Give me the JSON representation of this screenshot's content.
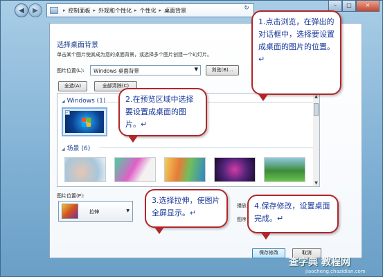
{
  "window": {
    "breadcrumbs": [
      "控制面板",
      "外观和个性化",
      "个性化",
      "桌面背景"
    ],
    "buttons": {
      "minimize": "–",
      "maximize": "□",
      "close": "×"
    }
  },
  "page": {
    "heading": "选择桌面背景",
    "description": "单击某个图片使其成为您的桌面背景，或选择多个图片创建一个幻灯片。",
    "location_label": "图片位置(L):",
    "location_value": "Windows 桌面背景",
    "browse_label": "浏览(B)...",
    "select_all_label": "全选(A)",
    "clear_all_label": "全部清除(C)"
  },
  "preview": {
    "groups": [
      {
        "name": "Windows (1)"
      },
      {
        "name": "场景 (6)"
      }
    ]
  },
  "position": {
    "label": "图片位置(P):",
    "value": "拉伸",
    "side_fragment_1": "播放",
    "side_fragment_2": "图序"
  },
  "actions": {
    "save_label": "保存修改",
    "cancel_label": "取消"
  },
  "callouts": [
    {
      "text": "1.点击浏览，在弹出的对话框中，选择要设置成桌面的图片的位置。↵"
    },
    {
      "text": "2.在预览区域中选择要设置成桌面的图片。↵"
    },
    {
      "text": "3.选择拉伸，使图片全屏显示。↵"
    },
    {
      "text": "4.保存修改，设置桌面完成。↵"
    }
  ],
  "watermark": {
    "site": "查字典 教程网",
    "url": "jiaocheng.chazidian.com"
  },
  "colors": {
    "callout_border": "#b0262a",
    "callout_text": "#1a3a9c",
    "heading": "#1a3f8a"
  }
}
